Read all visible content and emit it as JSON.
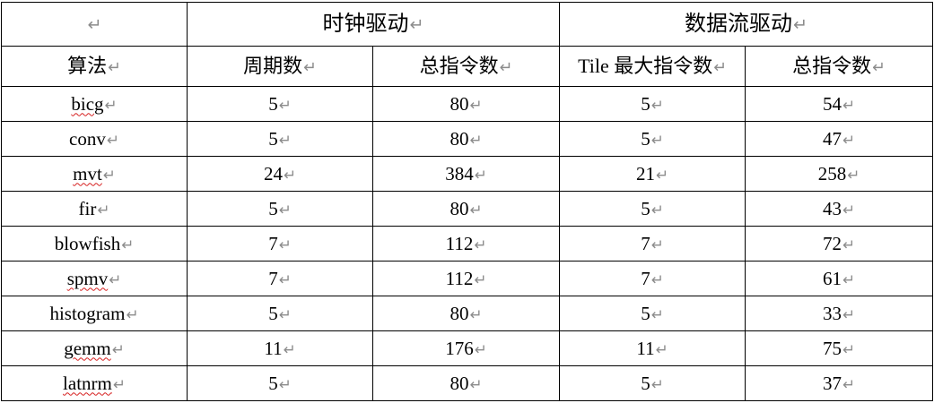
{
  "table": {
    "corner": "",
    "groups": [
      "时钟驱动",
      "数据流驱动"
    ],
    "headers": [
      "算法",
      "周期数",
      "总指令数",
      "Tile 最大指令数",
      "总指令数"
    ],
    "rows": [
      [
        "bicg",
        "5",
        "80",
        "5",
        "54"
      ],
      [
        "conv",
        "5",
        "80",
        "5",
        "47"
      ],
      [
        "mvt",
        "24",
        "384",
        "21",
        "258"
      ],
      [
        "fir",
        "5",
        "80",
        "5",
        "43"
      ],
      [
        "blowfish",
        "7",
        "112",
        "7",
        "72"
      ],
      [
        "spmv",
        "7",
        "112",
        "7",
        "61"
      ],
      [
        "histogram",
        "5",
        "80",
        "5",
        "33"
      ],
      [
        "gemm",
        "11",
        "176",
        "11",
        "75"
      ],
      [
        "latnrm",
        "5",
        "80",
        "5",
        "37"
      ]
    ]
  },
  "paragraph_mark": "↵",
  "spellcheck_flagged_rows": [
    0,
    2,
    5,
    7,
    8
  ],
  "colors": {
    "border": "#000000",
    "mark": "#8c8c8c",
    "spellcheck": "#d62020"
  }
}
